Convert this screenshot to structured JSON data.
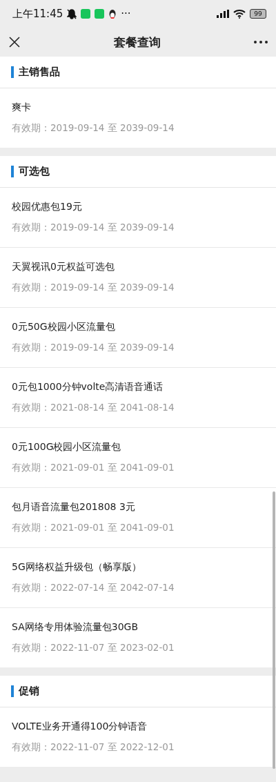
{
  "status_bar": {
    "time": "上午11:45",
    "more": "···",
    "battery": "99"
  },
  "nav": {
    "title": "套餐查询"
  },
  "sections": [
    {
      "title": "主销售品",
      "items": [
        {
          "name": "爽卡",
          "validity": "有效期：2019-09-14 至 2039-09-14"
        }
      ]
    },
    {
      "title": "可选包",
      "items": [
        {
          "name": "校园优惠包19元",
          "validity": "有效期：2019-09-14 至 2039-09-14"
        },
        {
          "name": "天翼视讯0元权益可选包",
          "validity": "有效期：2019-09-14 至 2039-09-14"
        },
        {
          "name": "0元50G校园小区流量包",
          "validity": "有效期：2019-09-14 至 2039-09-14"
        },
        {
          "name": "0元包1000分钟volte高清语音通话",
          "validity": "有效期：2021-08-14 至 2041-08-14"
        },
        {
          "name": "0元100G校园小区流量包",
          "validity": "有效期：2021-09-01 至 2041-09-01"
        },
        {
          "name": "包月语音流量包201808 3元",
          "validity": "有效期：2021-09-01 至 2041-09-01"
        },
        {
          "name": "5G网络权益升级包（畅享版）",
          "validity": "有效期：2022-07-14 至 2042-07-14"
        },
        {
          "name": "SA网络专用体验流量包30GB",
          "validity": "有效期：2022-11-07 至 2023-02-01"
        }
      ]
    },
    {
      "title": "促销",
      "items": [
        {
          "name": "VOLTE业务开通得100分钟语音",
          "validity": "有效期：2022-11-07 至 2022-12-01"
        }
      ]
    }
  ]
}
